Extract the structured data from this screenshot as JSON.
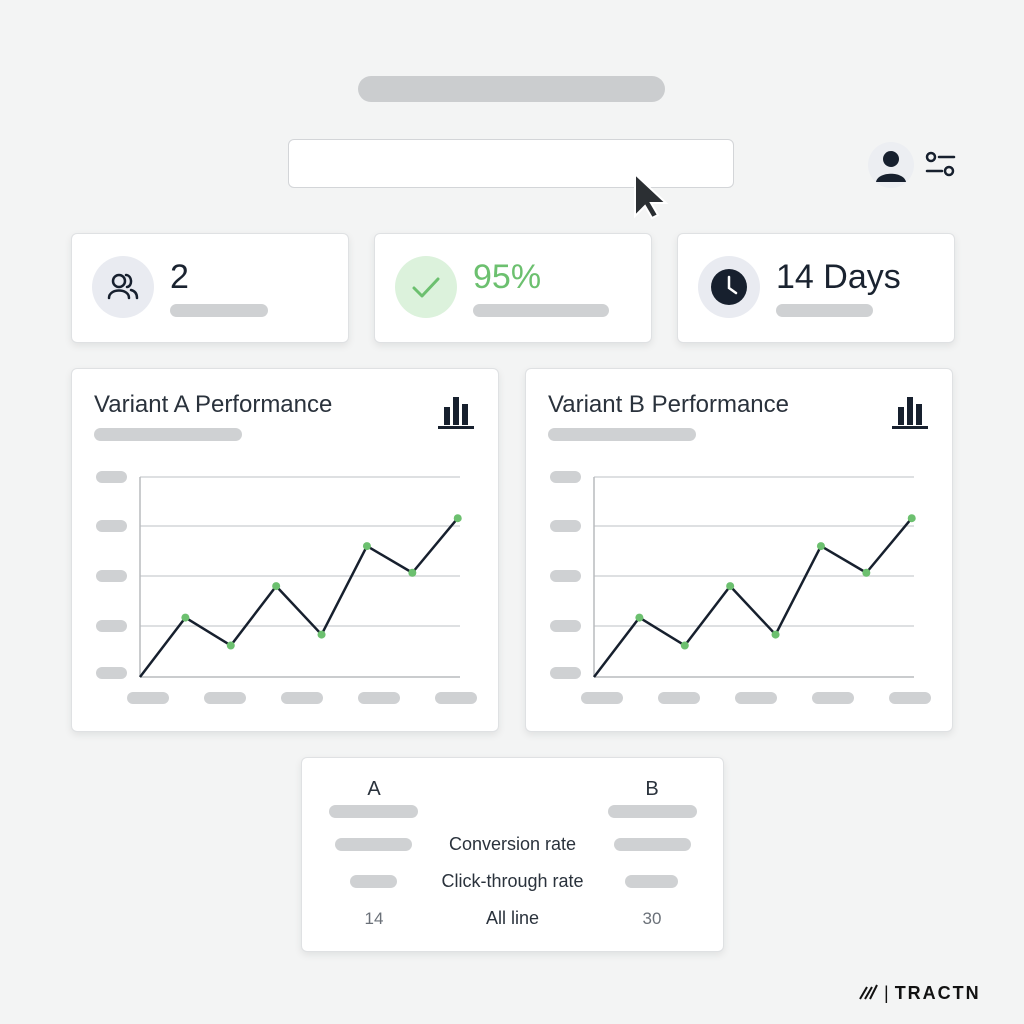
{
  "search": {
    "value": "",
    "placeholder": ""
  },
  "stats": [
    {
      "value": "2",
      "icon": "users-icon"
    },
    {
      "value": "95%",
      "icon": "check-icon",
      "color": "#6cc06f"
    },
    {
      "value": "14 Days",
      "icon": "clock-icon"
    }
  ],
  "charts": {
    "a": {
      "title": "Variant A Performance"
    },
    "b": {
      "title": "Variant B Performance"
    }
  },
  "chart_data": [
    {
      "type": "line",
      "title": "Variant A Performance",
      "x": [
        0,
        1,
        2,
        3,
        4,
        5,
        6,
        7,
        8
      ],
      "values": [
        0,
        0.49,
        0.26,
        0.75,
        0.35,
        1.08,
        0.86,
        1.31
      ],
      "grid": true,
      "line_color": "#17202e",
      "point_color": "#6cc06f"
    },
    {
      "type": "line",
      "title": "Variant B Performance",
      "x": [
        0,
        1,
        2,
        3,
        4,
        5,
        6,
        7,
        8
      ],
      "values": [
        0,
        0.49,
        0.26,
        0.75,
        0.35,
        1.08,
        0.86,
        1.31
      ],
      "grid": true,
      "line_color": "#17202e",
      "point_color": "#6cc06f"
    }
  ],
  "comparison": {
    "col_a": "A",
    "col_b": "B",
    "rows": [
      {
        "label": "Conversion rate",
        "a": "",
        "b": ""
      },
      {
        "label": "Click-through rate",
        "a": "",
        "b": ""
      },
      {
        "label": "All line",
        "a": "14",
        "b": "30"
      }
    ]
  },
  "brand": "TRACTN",
  "colors": {
    "accent_green": "#6cc06f",
    "navy": "#17202e",
    "skeleton": "#cfd1d3"
  }
}
